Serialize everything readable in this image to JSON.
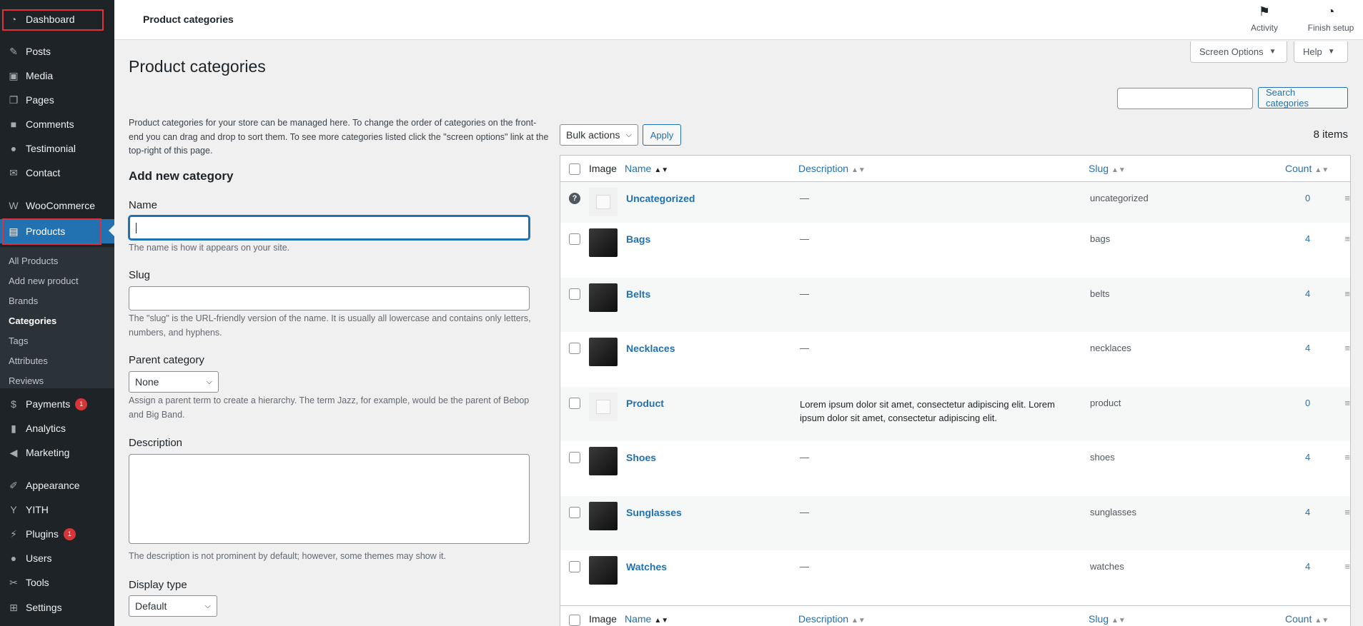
{
  "sidebar": {
    "items": [
      {
        "label": "Dashboard",
        "icon": "dashboard-icon"
      },
      {
        "label": "Posts",
        "icon": "pin-icon"
      },
      {
        "label": "Media",
        "icon": "media-icon"
      },
      {
        "label": "Pages",
        "icon": "pages-icon"
      },
      {
        "label": "Comments",
        "icon": "comment-icon"
      },
      {
        "label": "Testimonial",
        "icon": "user-icon"
      },
      {
        "label": "Contact",
        "icon": "mail-icon"
      },
      {
        "label": "WooCommerce",
        "icon": "woo-icon"
      },
      {
        "label": "Products",
        "icon": "archive-icon"
      },
      {
        "label": "Payments",
        "icon": "dollar-icon",
        "badge": "1"
      },
      {
        "label": "Analytics",
        "icon": "bar-chart-icon"
      },
      {
        "label": "Marketing",
        "icon": "megaphone-icon"
      },
      {
        "label": "Appearance",
        "icon": "brush-icon"
      },
      {
        "label": "YITH",
        "icon": "yith-icon"
      },
      {
        "label": "Plugins",
        "icon": "plugin-icon",
        "badge": "1"
      },
      {
        "label": "Users",
        "icon": "users-icon"
      },
      {
        "label": "Tools",
        "icon": "wrench-icon"
      },
      {
        "label": "Settings",
        "icon": "settings-icon"
      }
    ],
    "submenu": [
      "All Products",
      "Add new product",
      "Brands",
      "Categories",
      "Tags",
      "Attributes",
      "Reviews"
    ]
  },
  "topbar": {
    "title": "Product categories",
    "activity": "Activity",
    "finish_setup": "Finish setup"
  },
  "screen_options": "Screen Options",
  "help": "Help",
  "page_title": "Product categories",
  "search": {
    "button": "Search categories",
    "value": ""
  },
  "intro": "Product categories for your store can be managed here. To change the order of categories on the front-end you can drag and drop to sort them. To see more categories listed click the \"screen options\" link at the top-right of this page.",
  "form": {
    "heading": "Add new category",
    "name_label": "Name",
    "name_value": "",
    "name_hint": "The name is how it appears on your site.",
    "slug_label": "Slug",
    "slug_value": "",
    "slug_hint": "The \"slug\" is the URL-friendly version of the name. It is usually all lowercase and contains only letters, numbers, and hyphens.",
    "parent_label": "Parent category",
    "parent_value": "None",
    "parent_hint": "Assign a parent term to create a hierarchy. The term Jazz, for example, would be the parent of Bebop and Big Band.",
    "description_label": "Description",
    "description_value": "",
    "description_hint": "The description is not prominent by default; however, some themes may show it.",
    "display_type_label": "Display type",
    "display_type_value": "Default"
  },
  "bulk": {
    "label": "Bulk actions",
    "apply": "Apply"
  },
  "items_count": "8 items",
  "table": {
    "columns": {
      "image": "Image",
      "name": "Name",
      "description": "Description",
      "slug": "Slug",
      "count": "Count"
    },
    "rows": [
      {
        "name": "Uncategorized",
        "description": "—",
        "slug": "uncategorized",
        "count": "0"
      },
      {
        "name": "Bags",
        "description": "—",
        "slug": "bags",
        "count": "4"
      },
      {
        "name": "Belts",
        "description": "—",
        "slug": "belts",
        "count": "4"
      },
      {
        "name": "Necklaces",
        "description": "—",
        "slug": "necklaces",
        "count": "4"
      },
      {
        "name": "Product",
        "description": "Lorem ipsum dolor sit amet, consectetur adipiscing elit. Lorem ipsum dolor sit amet, consectetur adipiscing elit.",
        "slug": "product",
        "count": "0"
      },
      {
        "name": "Shoes",
        "description": "—",
        "slug": "shoes",
        "count": "4"
      },
      {
        "name": "Sunglasses",
        "description": "—",
        "slug": "sunglasses",
        "count": "4"
      },
      {
        "name": "Watches",
        "description": "—",
        "slug": "watches",
        "count": "4"
      }
    ]
  },
  "colors": {
    "accent": "#2271b1",
    "sidebar": "#1d2327",
    "badge": "#d63638",
    "highlight": "#e0313b"
  }
}
